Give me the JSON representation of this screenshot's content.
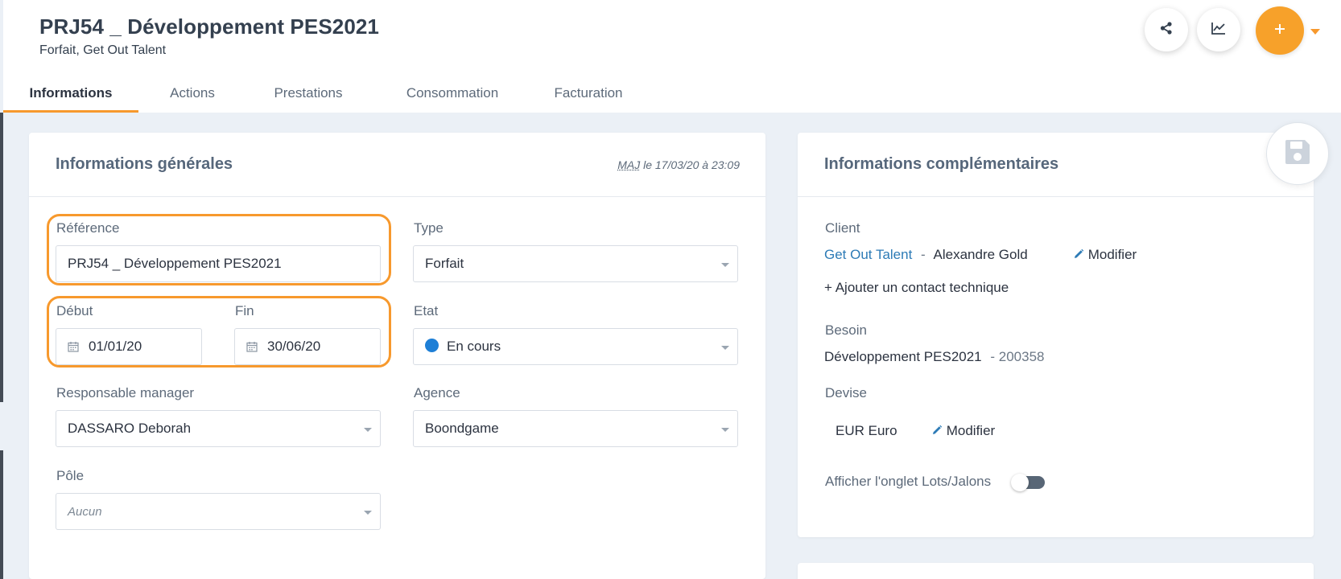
{
  "project": {
    "title": "PRJ54 _ Développement PES2021",
    "subtitle": "Forfait, Get Out Talent"
  },
  "tabs": [
    "Informations",
    "Actions",
    "Prestations",
    "Consommation",
    "Facturation"
  ],
  "actions": {
    "share_icon": "share-icon",
    "chart_icon": "chart-line-icon",
    "add_icon": "plus-icon",
    "save_icon": "floppy-disk-icon"
  },
  "general": {
    "title": "Informations générales",
    "maj_abbr": "MAJ",
    "maj_rest": " le 17/03/20 à 23:09",
    "reference_label": "Référence",
    "reference_value": "PRJ54 _ Développement PES2021",
    "type_label": "Type",
    "type_value": "Forfait",
    "debut_label": "Début",
    "debut_value": "01/01/20",
    "fin_label": "Fin",
    "fin_value": "30/06/20",
    "etat_label": "Etat",
    "etat_value": "En cours",
    "manager_label": "Responsable manager",
    "manager_value": "DASSARO Deborah",
    "agence_label": "Agence",
    "agence_value": "Boondgame",
    "pole_label": "Pôle",
    "pole_placeholder": "Aucun"
  },
  "complementary": {
    "title": "Informations complémentaires",
    "client_label": "Client",
    "client_company": "Get Out Talent",
    "client_separator": "-",
    "client_contact": "Alexandre Gold",
    "modify_label": "Modifier",
    "add_contact": "+ Ajouter un contact technique",
    "besoin_label": "Besoin",
    "besoin_value": "Développement PES2021",
    "besoin_ref": "- 200358",
    "devise_label": "Devise",
    "devise_value": "EUR Euro",
    "lots_label": "Afficher l'onglet Lots/Jalons",
    "lots_enabled": false
  },
  "colors": {
    "accent": "#f7992d",
    "link": "#2d7bb6",
    "status_en_cours": "#1e7fd6"
  }
}
